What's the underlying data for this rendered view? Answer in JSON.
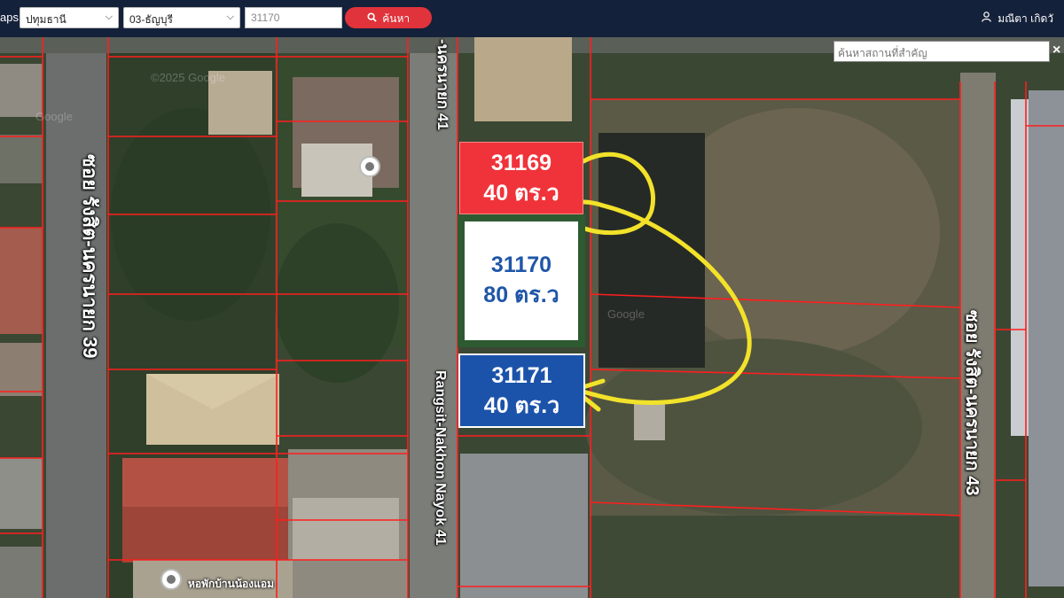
{
  "header": {
    "brand": "aps",
    "province": "ปทุมธานี",
    "amphoe": "03-ธัญบุรี",
    "parcel_value": "31170",
    "search_button": "ค้นหา",
    "user_name": "มณีตา เกิดวั"
  },
  "map": {
    "place_search_placeholder": "ค้นหาสถานที่สำคัญ",
    "close_label": "×",
    "roads": {
      "soi39": "ซอย รังสิต-นครนายก 39",
      "soi41_top": "-นครนายก 41",
      "soi41_en": "Rangsit-Nakhon Nayok 41",
      "soi43": "ซอย รังสิต-นครนายก 43"
    },
    "poi_label": "หอพักบ้านน้องแอม",
    "watermarks": [
      "©2025 Google",
      "Google",
      "Google",
      "Google"
    ]
  },
  "parcels": [
    {
      "number": "31169",
      "area": "40 ตร.ว",
      "color": "#f0333a"
    },
    {
      "number": "31170",
      "area": "80 ตร.ว",
      "color": "#2d5a30"
    },
    {
      "number": "31171",
      "area": "40 ตร.ว",
      "color": "#1c53aa"
    }
  ],
  "colors": {
    "topbar": "#14213a",
    "search_button": "#e0333b",
    "parcel_lines": "#ff1e1e",
    "arrow": "#f2e22a"
  }
}
